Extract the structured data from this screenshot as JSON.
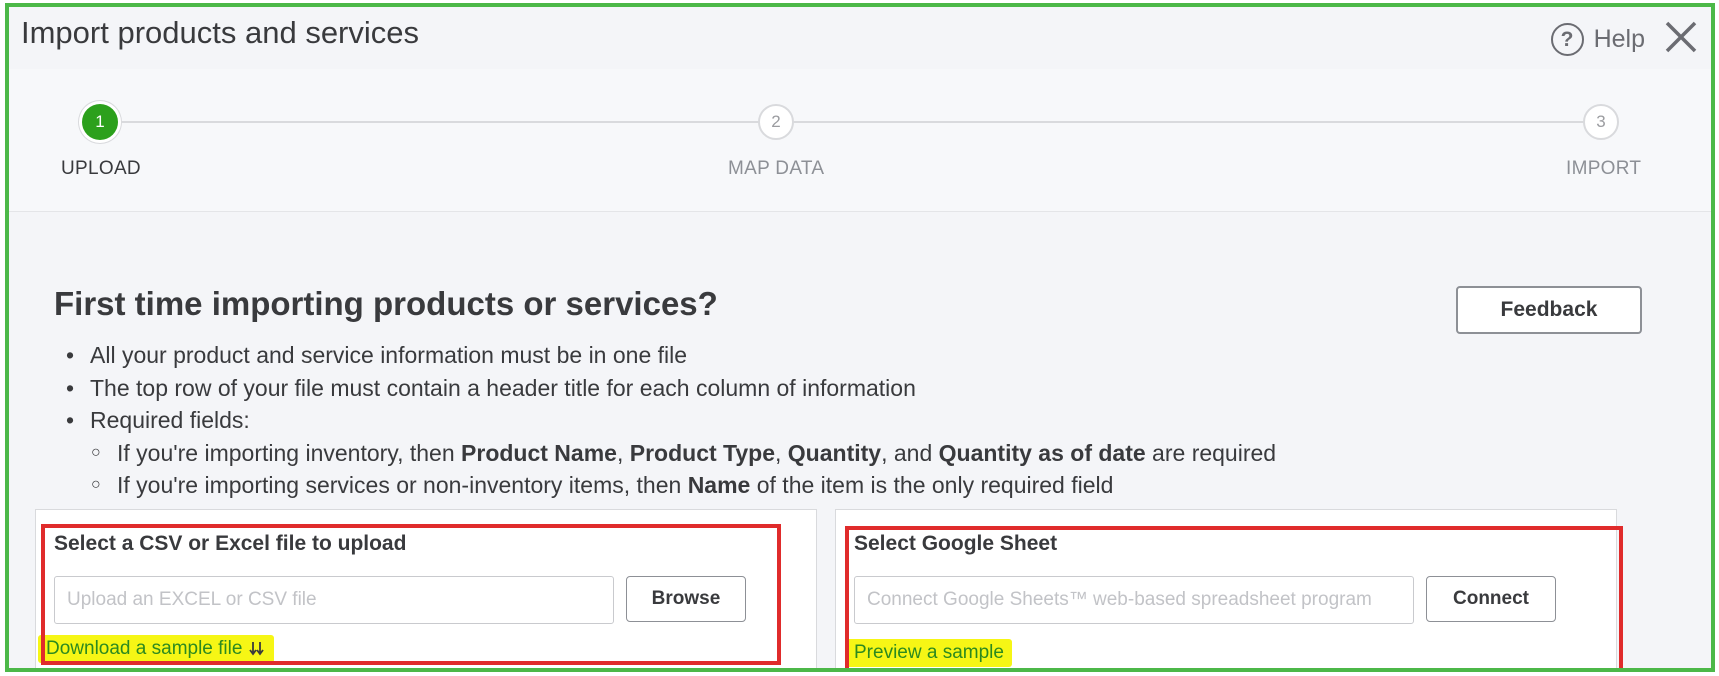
{
  "window": {
    "title": "Import products and services",
    "help_label": "Help",
    "help_icon": "?",
    "close_icon": "close-icon"
  },
  "stepper": {
    "steps": [
      {
        "number": "1",
        "label": "UPLOAD",
        "state": "active"
      },
      {
        "number": "2",
        "label": "MAP DATA",
        "state": "inactive"
      },
      {
        "number": "3",
        "label": "IMPORT",
        "state": "inactive"
      }
    ]
  },
  "main": {
    "heading": "First time importing products or services?",
    "feedback_label": "Feedback",
    "bullets": [
      "All your product and service information must be in one file",
      "The top row of your file must contain a header title for each column of information",
      "Required fields:"
    ],
    "sub_bullets": {
      "inventory": {
        "prefix": "If you're importing inventory, then ",
        "f1": "Product Name",
        "sep1": ", ",
        "f2": "Product Type",
        "sep2": ", ",
        "f3": "Quantity",
        "sep3": ", and ",
        "f4": "Quantity as of date",
        "suffix": " are required"
      },
      "services": {
        "prefix": "If you're importing services or non-inventory items, then ",
        "f1": "Name",
        "suffix": " of the item is the only required field"
      }
    }
  },
  "upload_card": {
    "title": "Select a CSV or Excel file to upload",
    "placeholder": "Upload an EXCEL or CSV file",
    "button_label": "Browse",
    "link_label": "Download a sample file",
    "link_icon": "download-icon"
  },
  "google_card": {
    "title": "Select Google Sheet",
    "placeholder": "Connect Google Sheets™ web-based spreadsheet program",
    "button_label": "Connect",
    "link_label": "Preview a sample"
  },
  "colors": {
    "frame_border": "#4cb848",
    "annotation_box": "#e02b2b",
    "highlight": "#f6f615",
    "accent_green": "#2ca01c"
  }
}
